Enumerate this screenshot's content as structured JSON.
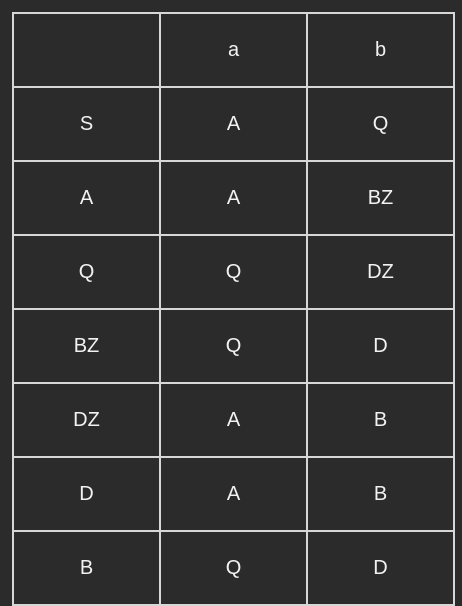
{
  "table": {
    "header": [
      "",
      "a",
      "b"
    ],
    "rows": [
      [
        "S",
        "A",
        "Q"
      ],
      [
        "A",
        "A",
        "BZ"
      ],
      [
        "Q",
        "Q",
        "DZ"
      ],
      [
        "BZ",
        "Q",
        "D"
      ],
      [
        "DZ",
        "A",
        "B"
      ],
      [
        "D",
        "A",
        "B"
      ],
      [
        "B",
        "Q",
        "D"
      ]
    ]
  },
  "colors": {
    "background": "#2b2b2b",
    "grid_lines": "#d7d7d7",
    "text": "#f2f2f2"
  }
}
